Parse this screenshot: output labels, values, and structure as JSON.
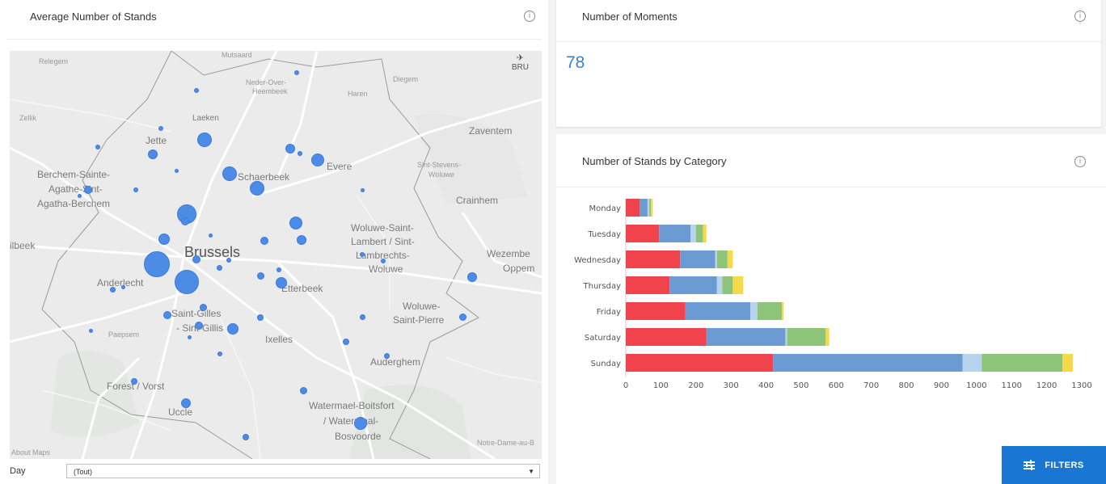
{
  "left_panel": {
    "title": "Average Number of Stands",
    "map": {
      "compass_label": "BRU",
      "about": "About Maps",
      "labels": [
        "Relegem",
        "Mutsaard",
        "Neder-Over-",
        "Heembeek",
        "Haren",
        "Diegem",
        "Laeken",
        "Jette",
        "Zellik",
        "Zaventem",
        "Sint-Stevens-",
        "Woluwe",
        "Berchem-Sainte-",
        "Agathe-Sint-",
        "Agatha-Berchem",
        "Schaerbeek",
        "Evere",
        "Crainhem",
        "Woluwe-Saint-",
        "Lambert / Sint-",
        "Lambrechts-",
        "Woluwe",
        "ilbeek",
        "Brussels",
        "Anderlecht",
        "Etterbeek",
        "Wezembe",
        "Oppem",
        "Saint-Gilles",
        "- Sint-Gillis",
        "Ixelles",
        "Woluwe-",
        "Saint-Pierre",
        "Paepsem",
        "Auderghem",
        "Forest / Vorst",
        "Uccle",
        "Watermael-Boitsfort",
        "/ Watermaal-",
        "Bosvoorde",
        "Notre-Dame-au-B"
      ]
    },
    "filter": {
      "label": "Day",
      "value": "(Tout)"
    }
  },
  "moments_panel": {
    "title": "Number of Moments",
    "value": "78"
  },
  "stands_panel": {
    "title": "Number of Stands by Category"
  },
  "filters_button": {
    "label": "FILTERS"
  },
  "chart_data": {
    "type": "bar",
    "orientation": "horizontal",
    "stacked": true,
    "categories": [
      "Monday",
      "Tuesday",
      "Wednesday",
      "Thursday",
      "Friday",
      "Saturday",
      "Sunday"
    ],
    "series": [
      {
        "color": "#f0434b",
        "values": [
          40,
          95,
          155,
          125,
          170,
          230,
          420
        ]
      },
      {
        "color": "#6b9bd2",
        "values": [
          22,
          90,
          100,
          135,
          185,
          225,
          540
        ]
      },
      {
        "color": "#b8d3ee",
        "values": [
          5,
          15,
          5,
          15,
          20,
          5,
          55
        ]
      },
      {
        "color": "#8ec47a",
        "values": [
          5,
          20,
          30,
          30,
          70,
          110,
          230
        ]
      },
      {
        "color": "#f5d948",
        "values": [
          5,
          10,
          15,
          30,
          5,
          10,
          30
        ]
      }
    ],
    "xlim": [
      0,
      1300
    ],
    "xticks": [
      0,
      100,
      200,
      300,
      400,
      500,
      600,
      700,
      800,
      900,
      1000,
      1100,
      1200,
      1300
    ]
  },
  "colors": {
    "bubble": "#4c8ce6",
    "kpi": "#3b82c4",
    "button": "#1976d2"
  }
}
